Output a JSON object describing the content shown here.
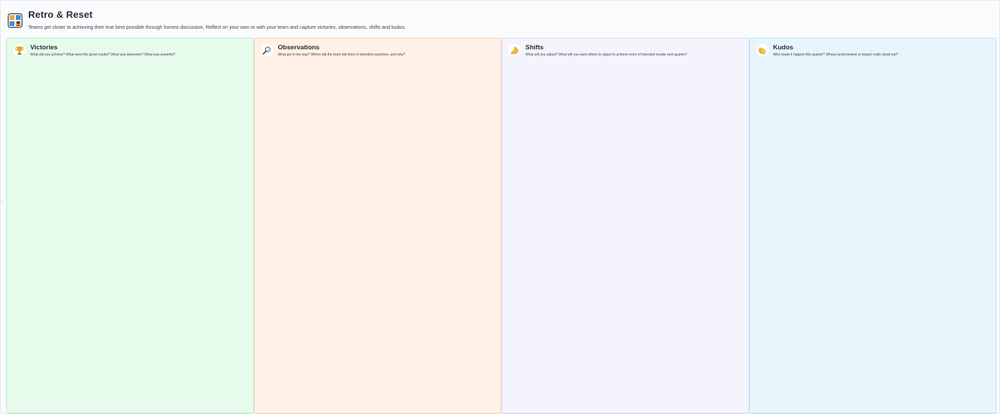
{
  "app": {
    "title": "Retro & Reset",
    "subtitle": "Teams get closer to achieving their true best possible through honest discussion. Reflect on your own or with your team and capture victories, observations, shifts and kudos.",
    "header_icon": "puzzle-team-icon"
  },
  "columns": [
    {
      "title": "Victories",
      "prompt": "What did you achieve? What were the great results? What was awesome? What was powerful?",
      "icon": "trophy-icon",
      "color": "#e6fbec"
    },
    {
      "title": "Observations",
      "prompt": "What got in the way? Where did the team fall short of intended outcomes, and why?",
      "icon": "magnifier-icon",
      "color": "#fff1e6"
    },
    {
      "title": "Shifts",
      "prompt": "What will you adjust? What will you want others to adjust to achieve more of intended results next quarter?",
      "icon": "flexed-arm-icon",
      "color": "#f4f4fc"
    },
    {
      "title": "Kudos",
      "prompt": "Who made it happen this quarter? Whose achievement or impact really stood out?",
      "icon": "clapping-hands-icon",
      "color": "#e7f5fd"
    }
  ]
}
